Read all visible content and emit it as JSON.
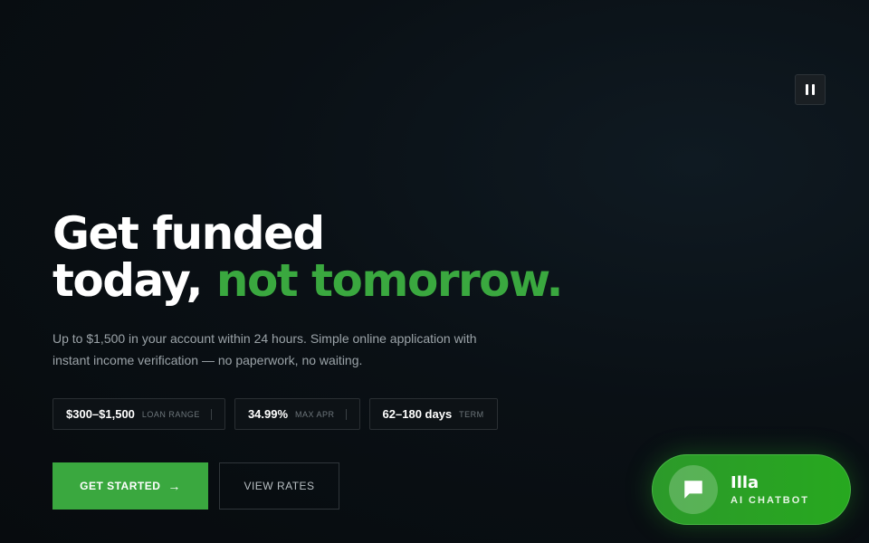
{
  "controls": {
    "pause_icon": "pause-icon"
  },
  "hero": {
    "headline_line1": "Get funded",
    "headline_line2_prefix": "today, ",
    "headline_line2_accent": "not tomorrow.",
    "subtext": "Up to $1,500 in your account within 24 hours. Simple online application with instant income verification — no paperwork, no waiting."
  },
  "stats": [
    {
      "value": "$300–$1,500",
      "label": "LOAN RANGE"
    },
    {
      "value": "34.99%",
      "label": "MAX APR"
    },
    {
      "value": "62–180 days",
      "label": "TERM"
    }
  ],
  "cta": {
    "primary_label": "GET STARTED",
    "primary_icon": "arrow-right-icon",
    "secondary_label": "VIEW RATES"
  },
  "chatbot": {
    "name": "Illa",
    "role": "AI CHATBOT",
    "icon": "chat-bubble-icon"
  },
  "colors": {
    "accent": "#3aa83f",
    "chat_green": "#2c9a2a",
    "background": "#0a1015"
  }
}
